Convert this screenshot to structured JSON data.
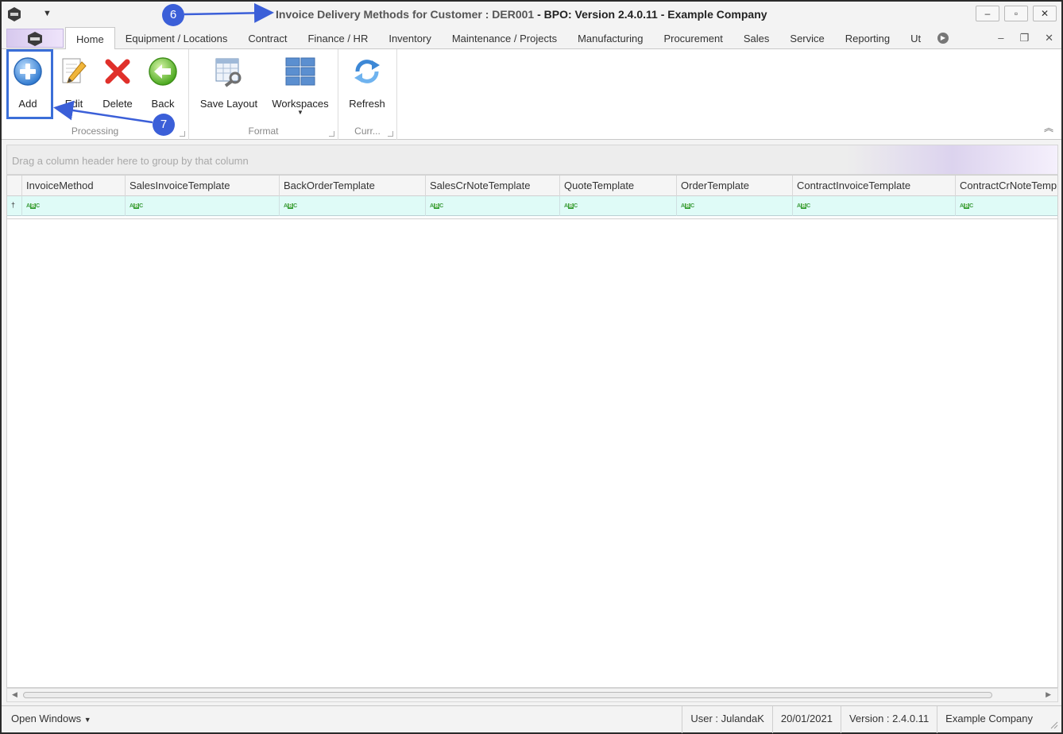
{
  "window": {
    "title_prefix": "Invoice Delivery Methods for Customer : DER001",
    "title_suffix": " - BPO: Version 2.4.0.11 - Example Company",
    "controls": {
      "minimize": "–",
      "restore": "▫",
      "close": "✕"
    }
  },
  "tabs": [
    {
      "label": "Home",
      "active": true
    },
    {
      "label": "Equipment / Locations"
    },
    {
      "label": "Contract"
    },
    {
      "label": "Finance / HR"
    },
    {
      "label": "Inventory"
    },
    {
      "label": "Maintenance / Projects"
    },
    {
      "label": "Manufacturing"
    },
    {
      "label": "Procurement"
    },
    {
      "label": "Sales"
    },
    {
      "label": "Service"
    },
    {
      "label": "Reporting"
    },
    {
      "label": "Ut"
    }
  ],
  "ribbon": {
    "processing": {
      "label": "Processing",
      "buttons": {
        "add": "Add",
        "edit": "Edit",
        "delete": "Delete",
        "back": "Back"
      }
    },
    "format": {
      "label": "Format",
      "buttons": {
        "save_layout": "Save Layout",
        "workspaces": "Workspaces"
      }
    },
    "current": {
      "label": "Curr...",
      "buttons": {
        "refresh": "Refresh"
      }
    }
  },
  "annotations": {
    "badge6": "6",
    "badge7": "7"
  },
  "grid": {
    "group_panel_hint": "Drag a column header here to group by that column",
    "columns": [
      "InvoiceMethod",
      "SalesInvoiceTemplate",
      "BackOrderTemplate",
      "SalesCrNoteTemplate",
      "QuoteTemplate",
      "OrderTemplate",
      "ContractInvoiceTemplate",
      "ContractCrNoteTemp"
    ],
    "filter_glyph": {
      "a": "A",
      "b": "B",
      "c": "C"
    }
  },
  "statusbar": {
    "open_windows": "Open Windows",
    "user": "User : JulandaK",
    "date": "20/01/2021",
    "version": "Version : 2.4.0.11",
    "company": "Example Company"
  },
  "colors": {
    "accent": "#3b6fd8",
    "filter_row": "#dffbf7",
    "delete_red": "#e0302a",
    "back_green": "#5bbf2a",
    "add_blue": "#3a86d8"
  }
}
